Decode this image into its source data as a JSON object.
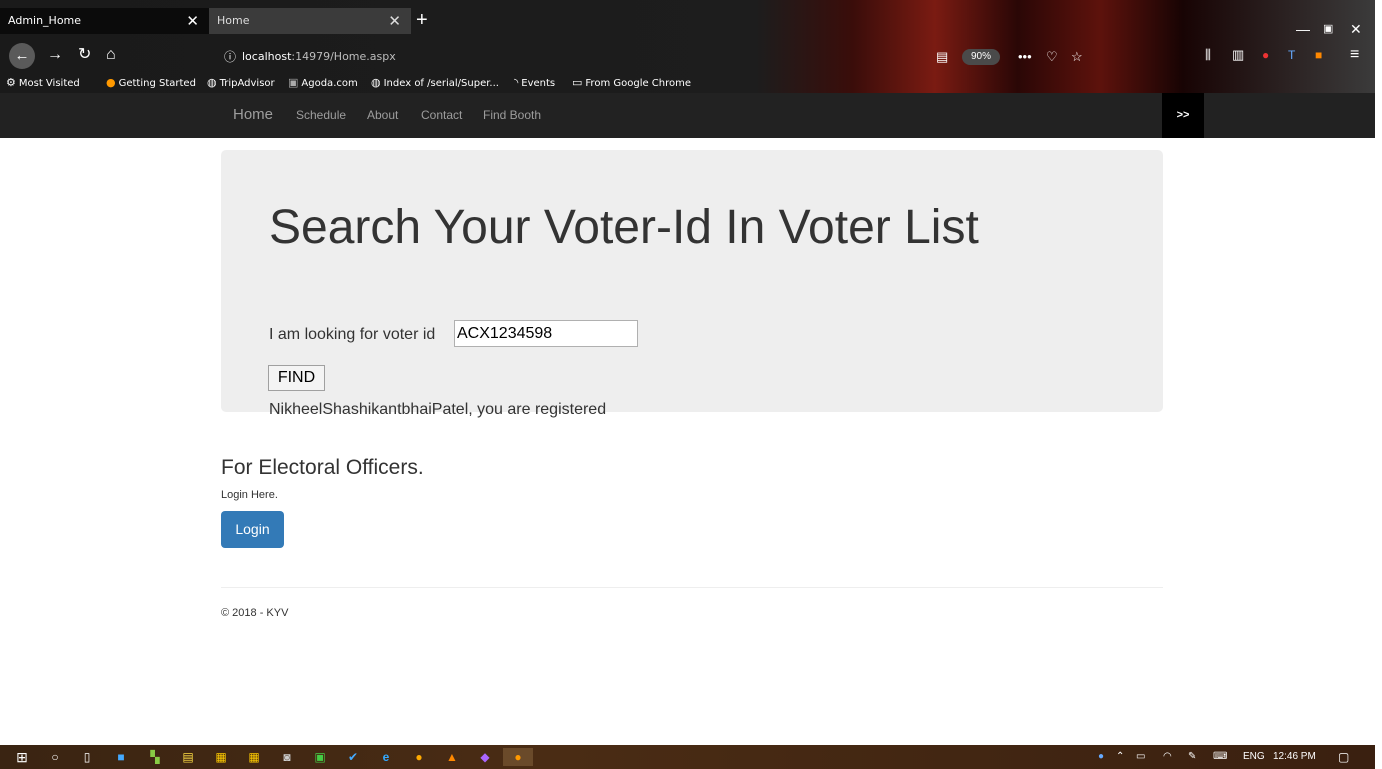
{
  "browser": {
    "tabs": [
      {
        "title": "Admin_Home",
        "close": "✕"
      },
      {
        "title": "Home",
        "close": "✕"
      }
    ],
    "new_tab": "+",
    "url": {
      "host": "localhost",
      "path": ":14979/Home.aspx"
    },
    "zoom": "90%",
    "bookmarks": [
      "Most Visited",
      "Getting Started",
      "TripAdvisor",
      "Agoda.com",
      "Index of /serial/Super...",
      "Events",
      "From Google Chrome"
    ]
  },
  "site_nav": {
    "brand": "Home",
    "links": [
      "Schedule",
      "About",
      "Contact",
      "Find Booth"
    ],
    "more": ">>"
  },
  "jumbotron": {
    "heading": "Search Your Voter-Id In Voter List",
    "input_label": "I am  looking for voter id",
    "voter_id": "ACX1234598",
    "find_button": "FIND",
    "result": "NikheelShashikantbhaiPatel, you are registered"
  },
  "officers": {
    "heading": "For Electoral Officers.",
    "subtext": "Login Here.",
    "login_button": "Login"
  },
  "footer": {
    "text": "© 2018 - KYV"
  },
  "taskbar": {
    "language": "ENG",
    "time": "12:46 PM"
  }
}
